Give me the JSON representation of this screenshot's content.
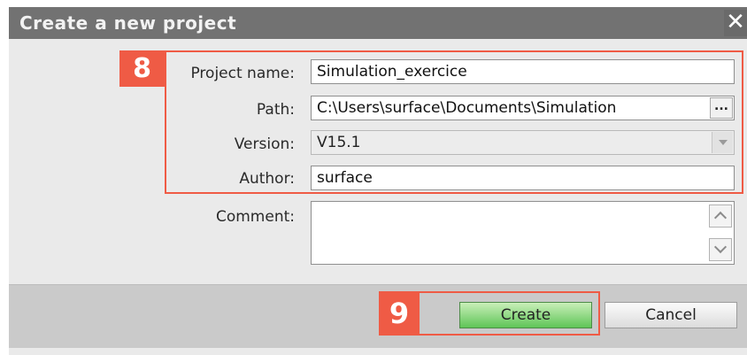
{
  "dialog": {
    "title": "Create a new project",
    "close_glyph": "✕"
  },
  "form": {
    "project_name": {
      "label": "Project name:",
      "value": "Simulation_exercice"
    },
    "path": {
      "label": "Path:",
      "value": "C:\\Users\\surface\\Documents\\Simulation",
      "browse_label": "..."
    },
    "version": {
      "label": "Version:",
      "value": "V15.1"
    },
    "author": {
      "label": "Author:",
      "value": "surface"
    },
    "comment": {
      "label": "Comment:",
      "value": ""
    }
  },
  "buttons": {
    "create_label": "Create",
    "cancel_label": "Cancel"
  },
  "annotations": {
    "step_fields": "8",
    "step_create": "9",
    "color": "#ef5b45"
  },
  "icons": {
    "close": "close-icon",
    "browse": "ellipsis-icon",
    "dropdown": "chevron-down-icon",
    "scroll_up": "chevron-up-icon",
    "scroll_down": "chevron-down-icon"
  }
}
